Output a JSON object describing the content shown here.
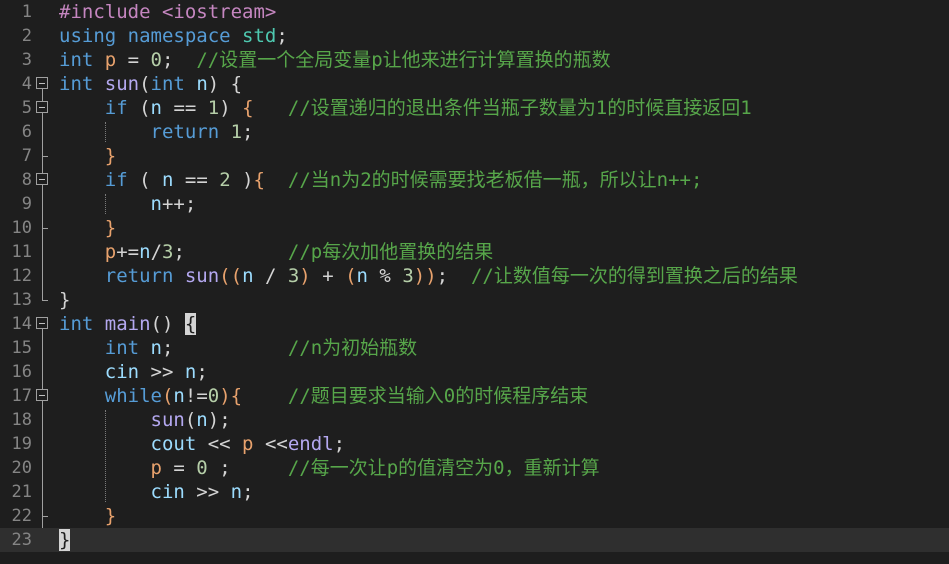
{
  "editor": {
    "language": "C++",
    "current_line": 23,
    "lines": [
      {
        "num": "1",
        "tokens": [
          {
            "t": "#include <iostream>",
            "c": "pp"
          }
        ]
      },
      {
        "num": "2",
        "tokens": [
          {
            "t": "using namespace ",
            "c": "kw"
          },
          {
            "t": "std",
            "c": "ns"
          },
          {
            "t": ";",
            "c": "plain"
          }
        ]
      },
      {
        "num": "3",
        "tokens": [
          {
            "t": "int ",
            "c": "kw"
          },
          {
            "t": "p",
            "c": "par"
          },
          {
            "t": " = ",
            "c": "op"
          },
          {
            "t": "0",
            "c": "num"
          },
          {
            "t": ";  ",
            "c": "plain"
          },
          {
            "t": "//设置一个全局变量p让他来进行计算置换的瓶数",
            "c": "cmt"
          }
        ]
      },
      {
        "num": "4",
        "fold": "open",
        "tokens": [
          {
            "t": "int ",
            "c": "kw"
          },
          {
            "t": "sun",
            "c": "fn"
          },
          {
            "t": "(",
            "c": "op"
          },
          {
            "t": "int ",
            "c": "kw"
          },
          {
            "t": "n",
            "c": "var"
          },
          {
            "t": ") ",
            "c": "op"
          },
          {
            "t": "{",
            "c": "plain"
          }
        ]
      },
      {
        "num": "5",
        "fold": "open",
        "tokens": [
          {
            "t": "    ",
            "c": "plain"
          },
          {
            "t": "if",
            "c": "kw"
          },
          {
            "t": " (",
            "c": "op"
          },
          {
            "t": "n",
            "c": "var"
          },
          {
            "t": " == ",
            "c": "op"
          },
          {
            "t": "1",
            "c": "num"
          },
          {
            "t": ") ",
            "c": "op"
          },
          {
            "t": "{",
            "c": "brace"
          },
          {
            "t": "   ",
            "c": "plain"
          },
          {
            "t": "//设置递归的退出条件当瓶子数量为1的时候直接返回1",
            "c": "cmt"
          }
        ]
      },
      {
        "num": "6",
        "tokens": [
          {
            "t": "        ",
            "c": "plain"
          },
          {
            "t": "return ",
            "c": "kw"
          },
          {
            "t": "1",
            "c": "num"
          },
          {
            "t": ";",
            "c": "plain"
          }
        ]
      },
      {
        "num": "7",
        "fold": "end",
        "tokens": [
          {
            "t": "    ",
            "c": "plain"
          },
          {
            "t": "}",
            "c": "brace"
          }
        ]
      },
      {
        "num": "8",
        "fold": "open",
        "tokens": [
          {
            "t": "    ",
            "c": "plain"
          },
          {
            "t": "if",
            "c": "kw"
          },
          {
            "t": " ( ",
            "c": "op"
          },
          {
            "t": "n",
            "c": "var"
          },
          {
            "t": " == ",
            "c": "op"
          },
          {
            "t": "2",
            "c": "num"
          },
          {
            "t": " )",
            "c": "op"
          },
          {
            "t": "{",
            "c": "brace"
          },
          {
            "t": "  ",
            "c": "plain"
          },
          {
            "t": "//当n为2的时候需要找老板借一瓶，所以让n++;",
            "c": "cmt"
          }
        ]
      },
      {
        "num": "9",
        "tokens": [
          {
            "t": "        ",
            "c": "plain"
          },
          {
            "t": "n",
            "c": "var"
          },
          {
            "t": "++;",
            "c": "plain"
          }
        ]
      },
      {
        "num": "10",
        "fold": "end",
        "tokens": [
          {
            "t": "    ",
            "c": "plain"
          },
          {
            "t": "}",
            "c": "brace"
          }
        ]
      },
      {
        "num": "11",
        "tokens": [
          {
            "t": "    ",
            "c": "plain"
          },
          {
            "t": "p",
            "c": "par"
          },
          {
            "t": "+=",
            "c": "op"
          },
          {
            "t": "n",
            "c": "var"
          },
          {
            "t": "/",
            "c": "op"
          },
          {
            "t": "3",
            "c": "num"
          },
          {
            "t": ";",
            "c": "plain"
          },
          {
            "t": "         ",
            "c": "plain"
          },
          {
            "t": "//p每次加他置换的结果",
            "c": "cmt"
          }
        ]
      },
      {
        "num": "12",
        "tokens": [
          {
            "t": "    ",
            "c": "plain"
          },
          {
            "t": "return ",
            "c": "kw"
          },
          {
            "t": "sun",
            "c": "fn"
          },
          {
            "t": "((",
            "c": "par"
          },
          {
            "t": "n",
            "c": "var"
          },
          {
            "t": " / ",
            "c": "op"
          },
          {
            "t": "3",
            "c": "num"
          },
          {
            "t": ")",
            "c": "par"
          },
          {
            "t": " + ",
            "c": "op"
          },
          {
            "t": "(",
            "c": "par"
          },
          {
            "t": "n",
            "c": "var"
          },
          {
            "t": " % ",
            "c": "op"
          },
          {
            "t": "3",
            "c": "num"
          },
          {
            "t": "))",
            "c": "par"
          },
          {
            "t": ";  ",
            "c": "plain"
          },
          {
            "t": "//让数值每一次的得到置换之后的结果",
            "c": "cmt"
          }
        ]
      },
      {
        "num": "13",
        "fold": "last",
        "tokens": [
          {
            "t": "}",
            "c": "plain"
          }
        ]
      },
      {
        "num": "14",
        "fold": "open",
        "tokens": [
          {
            "t": "int ",
            "c": "kw"
          },
          {
            "t": "main",
            "c": "fn"
          },
          {
            "t": "() ",
            "c": "op"
          },
          {
            "t": "{",
            "c": "hl"
          }
        ]
      },
      {
        "num": "15",
        "tokens": [
          {
            "t": "    ",
            "c": "plain"
          },
          {
            "t": "int ",
            "c": "kw"
          },
          {
            "t": "n",
            "c": "var"
          },
          {
            "t": ";",
            "c": "plain"
          },
          {
            "t": "          ",
            "c": "plain"
          },
          {
            "t": "//n为初始瓶数",
            "c": "cmt"
          }
        ]
      },
      {
        "num": "16",
        "tokens": [
          {
            "t": "    ",
            "c": "plain"
          },
          {
            "t": "cin",
            "c": "var"
          },
          {
            "t": " >> ",
            "c": "op"
          },
          {
            "t": "n",
            "c": "var"
          },
          {
            "t": ";",
            "c": "plain"
          }
        ]
      },
      {
        "num": "17",
        "fold": "open",
        "tokens": [
          {
            "t": "    ",
            "c": "plain"
          },
          {
            "t": "while",
            "c": "kw"
          },
          {
            "t": "(",
            "c": "par"
          },
          {
            "t": "n",
            "c": "var"
          },
          {
            "t": "!=",
            "c": "op"
          },
          {
            "t": "0",
            "c": "num"
          },
          {
            "t": ")",
            "c": "par"
          },
          {
            "t": "{",
            "c": "brace"
          },
          {
            "t": "    ",
            "c": "plain"
          },
          {
            "t": "//题目要求当输入0的时候程序结束",
            "c": "cmt"
          }
        ]
      },
      {
        "num": "18",
        "tokens": [
          {
            "t": "        ",
            "c": "plain"
          },
          {
            "t": "sun",
            "c": "fn"
          },
          {
            "t": "(",
            "c": "op"
          },
          {
            "t": "n",
            "c": "var"
          },
          {
            "t": ");",
            "c": "plain"
          }
        ]
      },
      {
        "num": "19",
        "tokens": [
          {
            "t": "        ",
            "c": "plain"
          },
          {
            "t": "cout",
            "c": "var"
          },
          {
            "t": " << ",
            "c": "op"
          },
          {
            "t": "p",
            "c": "par"
          },
          {
            "t": " <<",
            "c": "op"
          },
          {
            "t": "endl",
            "c": "fn"
          },
          {
            "t": ";",
            "c": "plain"
          }
        ]
      },
      {
        "num": "20",
        "tokens": [
          {
            "t": "        ",
            "c": "plain"
          },
          {
            "t": "p",
            "c": "par"
          },
          {
            "t": " = ",
            "c": "op"
          },
          {
            "t": "0",
            "c": "num"
          },
          {
            "t": " ;",
            "c": "plain"
          },
          {
            "t": "     ",
            "c": "plain"
          },
          {
            "t": "//每一次让p的值清空为0，重新计算",
            "c": "cmt"
          }
        ]
      },
      {
        "num": "21",
        "tokens": [
          {
            "t": "        ",
            "c": "plain"
          },
          {
            "t": "cin",
            "c": "var"
          },
          {
            "t": " >> ",
            "c": "op"
          },
          {
            "t": "n",
            "c": "var"
          },
          {
            "t": ";",
            "c": "plain"
          }
        ]
      },
      {
        "num": "22",
        "fold": "end",
        "tokens": [
          {
            "t": "    ",
            "c": "plain"
          },
          {
            "t": "}",
            "c": "brace"
          }
        ]
      },
      {
        "num": "23",
        "fold": "last",
        "tokens": [
          {
            "t": "}",
            "c": "hl"
          }
        ]
      }
    ]
  }
}
